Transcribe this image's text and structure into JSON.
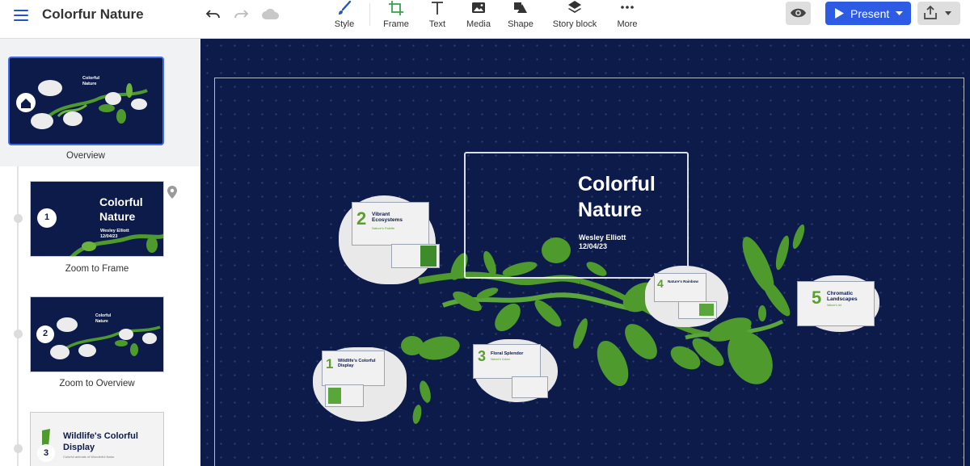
{
  "app": {
    "doc_title": "Colorfur Nature"
  },
  "toolbar": {
    "tools": [
      {
        "label": "Style",
        "icon": "brush-icon"
      },
      {
        "label": "Frame",
        "icon": "frame-icon"
      },
      {
        "label": "Text",
        "icon": "text-icon"
      },
      {
        "label": "Media",
        "icon": "image-icon"
      },
      {
        "label": "Shape",
        "icon": "shapes-icon"
      },
      {
        "label": "Story block",
        "icon": "layers-icon"
      },
      {
        "label": "More",
        "icon": "more-dots-icon"
      }
    ],
    "present_label": "Present",
    "accent_color": "#2d5be3"
  },
  "sidebar": {
    "overview": {
      "label": "Overview",
      "thumb_title": "Colorful Nature"
    },
    "items": [
      {
        "number": "1",
        "label": "Zoom to Frame",
        "thumb_title": "Colorful Nature",
        "thumb_author": "Wesley Elliott",
        "thumb_date": "12/04/23"
      },
      {
        "number": "2",
        "label": "Zoom to Overview",
        "thumb_title": "Colorful Nature"
      },
      {
        "number": "3",
        "label": "",
        "thumb_title": "Wildlife's Colorful Display",
        "thumb_subtitle": "Colorful animals of Wonderful Natur"
      }
    ]
  },
  "canvas": {
    "background_color": "#0d1b4b",
    "title": "Colorful Nature",
    "title_line1": "Colorful",
    "title_line2": "Nature",
    "author": "Wesley Elliott",
    "date": "12/04/23",
    "topics": [
      {
        "number": "1",
        "title": "Wildlife's Colorful Display"
      },
      {
        "number": "2",
        "title": "Vibrant Ecosystems",
        "subtitle": "Nature's Palette"
      },
      {
        "number": "3",
        "title": "Floral Splendor",
        "subtitle": "Nature's Colors"
      },
      {
        "number": "4",
        "title": "Nature's Rainbow"
      },
      {
        "number": "5",
        "title": "Chromatic Landscapes",
        "subtitle": "Nature's Art"
      }
    ]
  }
}
